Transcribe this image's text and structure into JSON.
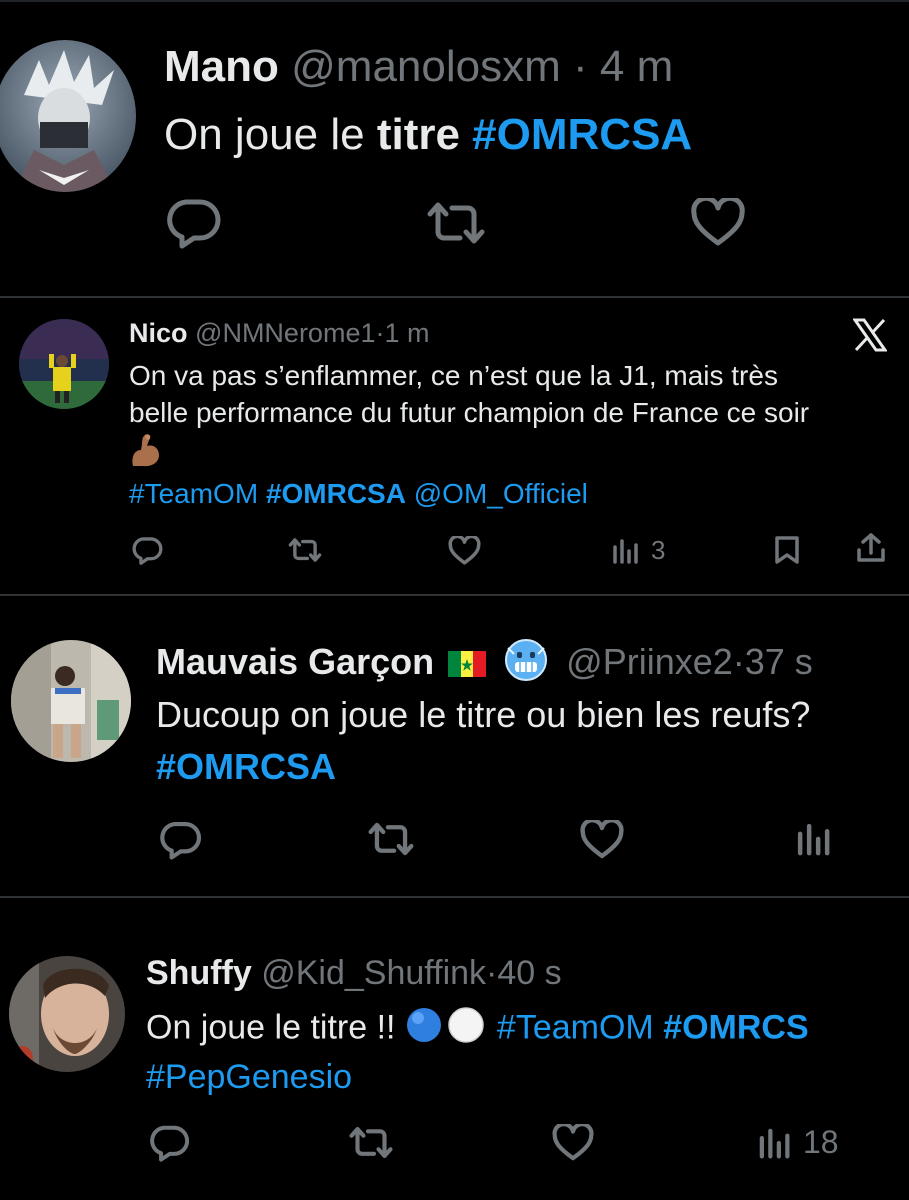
{
  "tweets": [
    {
      "name": "Mano",
      "handle": "@manolosxm",
      "sep": "·",
      "time": "4 m",
      "text_plain": "On joue le ",
      "text_bold": "titre",
      "hashtag": "#OMRCSA",
      "icons": [
        "reply-icon",
        "retweet-icon",
        "like-icon"
      ]
    },
    {
      "name": "Nico",
      "handle": "@NMNerome1",
      "sep": "·",
      "time": "1 m",
      "line1": "On va pas s’enflammer, ce n’est que la J1, mais très",
      "line2": "belle performance du futur champion de France ce soir",
      "emoji": "flexed-biceps",
      "tag1": "#TeamOM",
      "tag2": "#OMRCSA",
      "mention": "@OM_Officiel",
      "views": "3",
      "source_icon": "x-logo-icon"
    },
    {
      "name": "Mauvais Garçon",
      "handle": "@Priinxe2",
      "sep": "·",
      "time": "37 s",
      "line1": "Ducoup on joue le titre ou bien les reufs?",
      "hashtag": "#OMRCSA",
      "badges": [
        "senegal-flag-emoji",
        "cold-face-emoji"
      ]
    },
    {
      "name": "Shuffy",
      "handle": "@Kid_Shuffink",
      "sep": "·",
      "time": "40 s",
      "line1": "On joue le titre !! ",
      "tag1": "#TeamOM",
      "tag2": "#OMRCS",
      "tag3": "#PepGenesio",
      "emojis": [
        "blue-circle",
        "white-circle"
      ],
      "views": "18"
    }
  ],
  "colors": {
    "accent": "#1d9bf0",
    "muted": "#71767b",
    "text": "#e7e9ea",
    "bg": "#000000"
  }
}
